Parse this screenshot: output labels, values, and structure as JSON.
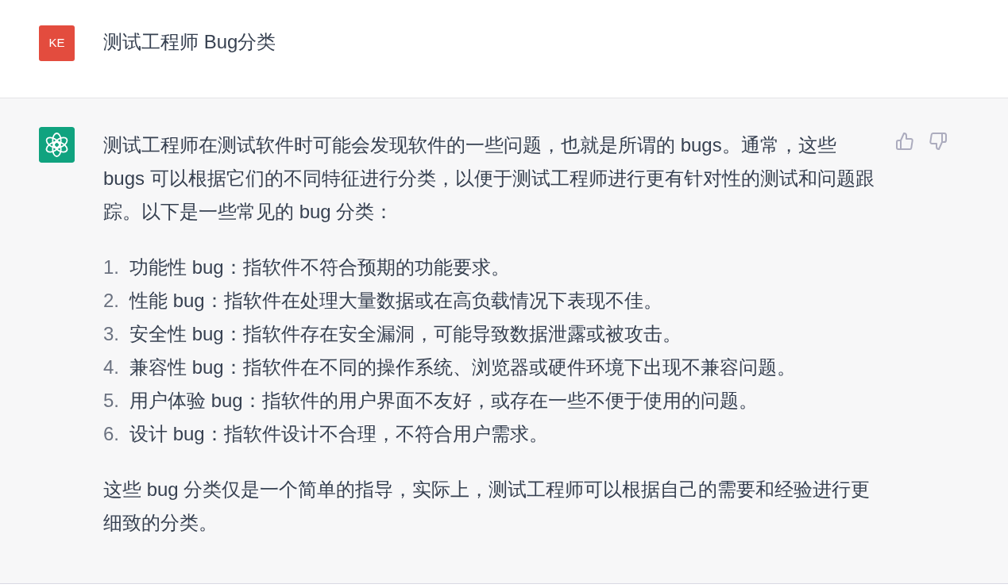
{
  "conversation": [
    {
      "kind": "user",
      "avatar": "KE",
      "text": "测试工程师 Bug分类"
    },
    {
      "kind": "assistant",
      "blocks": [
        {
          "kind": "paragraph",
          "text": "测试工程师在测试软件时可能会发现软件的一些问题，也就是所谓的 bugs。通常，这些 bugs 可以根据它们的不同特征进行分类，以便于测试工程师进行更有针对性的测试和问题跟踪。以下是一些常见的 bug 分类："
        },
        {
          "kind": "list",
          "items": [
            {
              "number": "1.",
              "text": "功能性 bug：指软件不符合预期的功能要求。"
            },
            {
              "number": "2.",
              "text": "性能 bug：指软件在处理大量数据或在高负载情况下表现不佳。"
            },
            {
              "number": "3.",
              "text": "安全性 bug：指软件存在安全漏洞，可能导致数据泄露或被攻击。"
            },
            {
              "number": "4.",
              "text": "兼容性 bug：指软件在不同的操作系统、浏览器或硬件环境下出现不兼容问题。"
            },
            {
              "number": "5.",
              "text": "用户体验 bug：指软件的用户界面不友好，或存在一些不便于使用的问题。"
            },
            {
              "number": "6.",
              "text": "设计 bug：指软件设计不合理，不符合用户需求。"
            }
          ]
        },
        {
          "kind": "paragraph",
          "text": "这些 bug 分类仅是一个简单的指导，实际上，测试工程师可以根据自己的需要和经验进行更细致的分类。"
        }
      ]
    }
  ]
}
